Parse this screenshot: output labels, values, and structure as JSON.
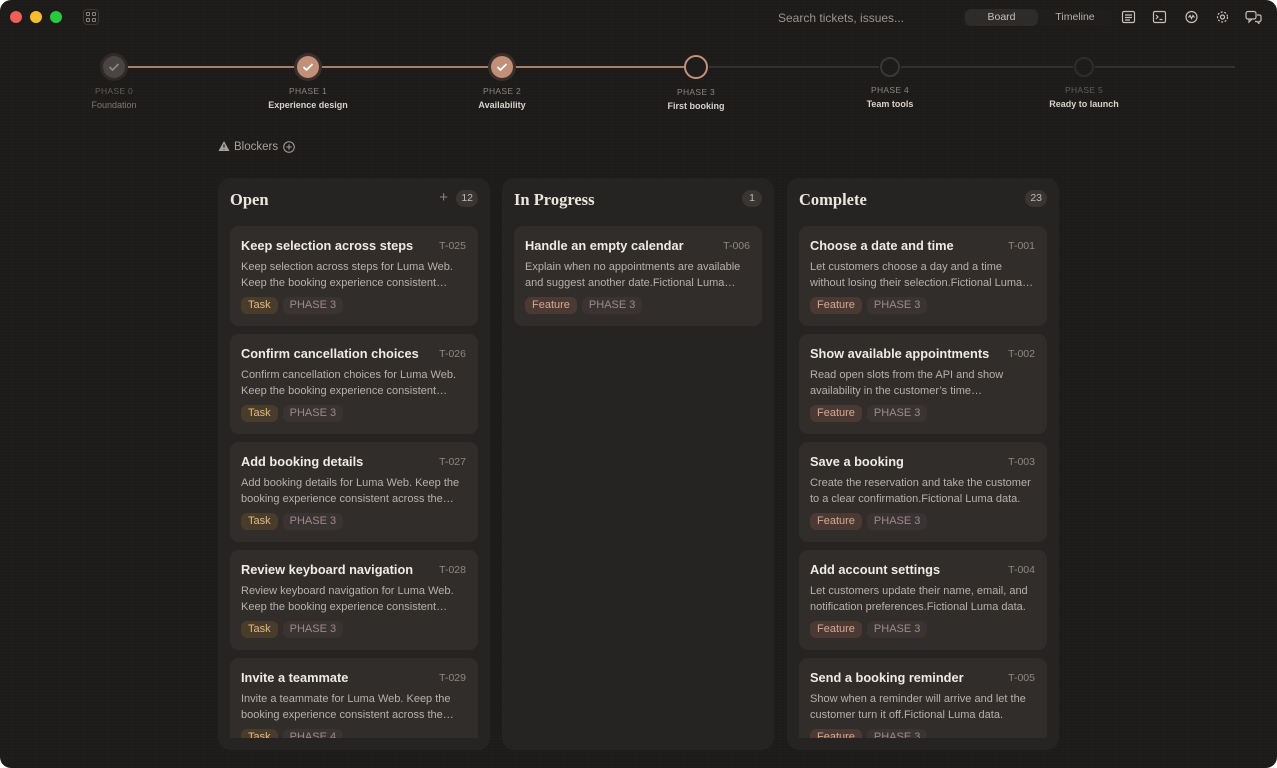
{
  "window": {
    "search_placeholder": "Search tickets, issues...",
    "view_tabs": [
      "Board",
      "Timeline"
    ],
    "active_view": "Board",
    "toolbar_icons": [
      "notes-icon",
      "terminal-icon",
      "activity-icon",
      "settings-icon",
      "chat-icon"
    ]
  },
  "phases": [
    {
      "kicker": "PHASE 0",
      "name": "Foundation",
      "status": "done-dim"
    },
    {
      "kicker": "PHASE 1",
      "name": "Experience design",
      "status": "done"
    },
    {
      "kicker": "PHASE 2",
      "name": "Availability",
      "status": "done"
    },
    {
      "kicker": "PHASE 3",
      "name": "First booking",
      "status": "current"
    },
    {
      "kicker": "PHASE 4",
      "name": "Team tools",
      "status": "todo"
    },
    {
      "kicker": "PHASE 5",
      "name": "Ready to launch",
      "status": "todo-dim"
    }
  ],
  "blockers": {
    "label": "Blockers"
  },
  "columns": {
    "open": {
      "title": "Open",
      "count": "12",
      "cards": [
        {
          "title": "Keep selection across steps",
          "id": "T-025",
          "desc": "Keep selection across steps for Luma Web. Keep the booking experience consistent across the flow.",
          "type": "Task",
          "phase": "PHASE 3"
        },
        {
          "title": "Confirm cancellation choices",
          "id": "T-026",
          "desc": "Confirm cancellation choices for Luma Web. Keep the booking experience consistent across the flow.",
          "type": "Task",
          "phase": "PHASE 3"
        },
        {
          "title": "Add booking details",
          "id": "T-027",
          "desc": "Add booking details for Luma Web. Keep the booking experience consistent across the flow.",
          "type": "Task",
          "phase": "PHASE 3"
        },
        {
          "title": "Review keyboard navigation",
          "id": "T-028",
          "desc": "Review keyboard navigation for Luma Web. Keep the booking experience consistent across the flow.",
          "type": "Task",
          "phase": "PHASE 3"
        },
        {
          "title": "Invite a teammate",
          "id": "T-029",
          "desc": "Invite a teammate for Luma Web. Keep the booking experience consistent across the flow.",
          "type": "Task",
          "phase": "PHASE 4"
        }
      ]
    },
    "in_progress": {
      "title": "In Progress",
      "count": "1",
      "cards": [
        {
          "title": "Handle an empty calendar",
          "id": "T-006",
          "desc": "Explain when no appointments are available and suggest another date.Fictional Luma data.",
          "type": "Feature",
          "phase": "PHASE 3"
        }
      ]
    },
    "complete": {
      "title": "Complete",
      "count": "23",
      "cards": [
        {
          "title": "Choose a date and time",
          "id": "T-001",
          "desc": "Let customers choose a day and a time without losing their selection.Fictional Luma data.",
          "type": "Feature",
          "phase": "PHASE 3"
        },
        {
          "title": "Show available appointments",
          "id": "T-002",
          "desc": "Read open slots from the API and show availability in the customer’s time zone.Fictional Luma data.",
          "type": "Feature",
          "phase": "PHASE 3"
        },
        {
          "title": "Save a booking",
          "id": "T-003",
          "desc": "Create the reservation and take the customer to a clear confirmation.Fictional Luma data.",
          "type": "Feature",
          "phase": "PHASE 3"
        },
        {
          "title": "Add account settings",
          "id": "T-004",
          "desc": "Let customers update their name, email, and notification preferences.Fictional Luma data.",
          "type": "Feature",
          "phase": "PHASE 3"
        },
        {
          "title": "Send a booking reminder",
          "id": "T-005",
          "desc": "Show when a reminder will arrive and let the customer turn it off.Fictional Luma data.",
          "type": "Feature",
          "phase": "PHASE 3"
        }
      ]
    }
  }
}
